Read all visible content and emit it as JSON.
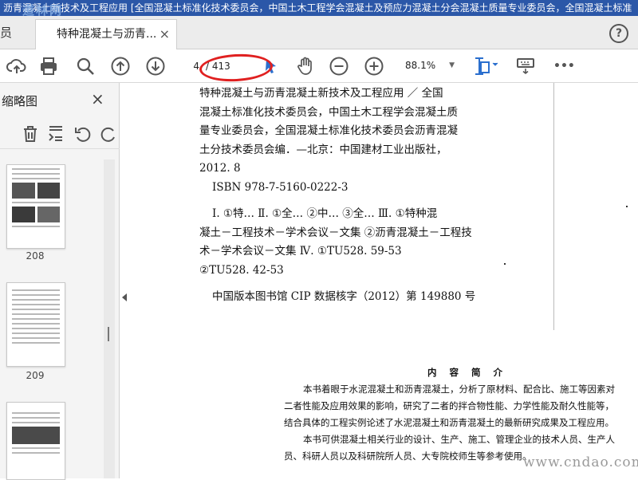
{
  "titlebar": {
    "text": "沥青混凝土新技术及工程应用 [全国混凝土标准化技术委员会，中国土木工程学会混凝土及预应力混凝土分会混凝土质量专业委员会，全国混凝土标准"
  },
  "tabs": {
    "home_label": "员",
    "doc_label": "特种混凝土与沥青...",
    "close": "×",
    "help": "?"
  },
  "toolbar": {
    "current_page": "4",
    "page_total": "/ 413",
    "zoom": "88.1%",
    "more": "•••"
  },
  "sidepanel": {
    "title": "缩略图",
    "close": "×",
    "thumbnails": [
      {
        "label": "208"
      },
      {
        "label": "209"
      }
    ]
  },
  "document": {
    "cip_lines": [
      "特种混凝土与沥青混凝土新技术及工程应用 ／ 全国",
      "混凝土标准化技术委员会，中国土木工程学会混凝土质",
      "量专业委员会，全国混凝土标准化技术委员会沥青混凝",
      "土分技术委员会编．—北京：中国建材工业出版社，",
      "2012. 8",
      "ISBN 978-7-5160-0222-3",
      "Ⅰ. ①特…  Ⅱ. ①全…  ②中…  ③全…  Ⅲ. ①特种混",
      "凝土－工程技术－学术会议－文集  ②沥青混凝土－工程技",
      "术－学术会议－文集  Ⅳ. ①TU528. 59-53",
      "②TU528. 42-53",
      "中国版本图书馆 CIP 数据核字（2012）第 149880 号"
    ],
    "summary_heading": "内 容 简 介",
    "summary_lines": [
      "本书着眼于水泥混凝土和沥青混凝土，分析了原材料、配合比、施工等因素对",
      "二者性能及应用效果的影响，研究了二者的拌合物性能、力学性能及耐久性能等，",
      "结合具体的工程实例论述了水泥混凝土和沥青混凝土的最新研究成果及工程应用。",
      "本书可供混凝土相关行业的设计、生产、施工、管理企业的技术人员、生产人",
      "员、科研人员以及科研院所人员、大专院校师生等参考使用。"
    ],
    "site_mark": "www.cndao.com"
  },
  "watermark": "道林网",
  "colors": {
    "titlebar": "#2b57a8",
    "annotation_red": "#e02020",
    "accent_blue": "#2b6fce"
  }
}
